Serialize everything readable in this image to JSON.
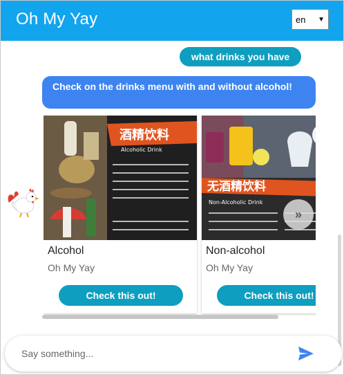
{
  "header": {
    "title": "Oh My Yay",
    "language": {
      "selected": "en"
    },
    "color": "#12a5ee"
  },
  "chat": {
    "user_message": "what drinks you have",
    "bot_message": "Check on the drinks menu with and without alcohol!",
    "colors": {
      "user_bubble": "#0e9ebf",
      "bot_bubble": "#3d84f0"
    }
  },
  "cards": [
    {
      "image_title_cn": "酒精饮料",
      "image_title_en": "Alcoholic Drink",
      "title": "Alcohol",
      "subtitle": "Oh My Yay",
      "button": "Check this out!"
    },
    {
      "image_title_cn": "无酒精饮料",
      "image_title_en": "Non-Alcoholic Drink",
      "title": "Non-alcohol",
      "subtitle": "Oh My Yay",
      "button": "Check this out!"
    }
  ],
  "carousel": {
    "next_icon": "double-chevron-right-icon"
  },
  "composer": {
    "placeholder": "Say something...",
    "send_icon": "send-icon"
  }
}
